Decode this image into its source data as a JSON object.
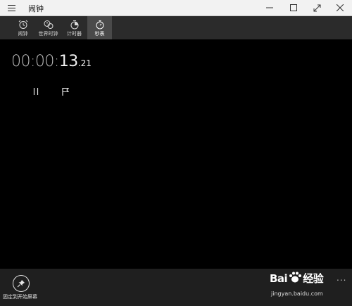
{
  "window": {
    "title": "闹钟",
    "controls": {
      "minimize_icon": "minimize-icon",
      "maximize_icon": "maximize-icon",
      "fullscreen_icon": "fullscreen-icon",
      "close_icon": "close-icon"
    }
  },
  "tabs": [
    {
      "label": "闹钟",
      "icon": "alarm-icon",
      "active": false
    },
    {
      "label": "世界时钟",
      "icon": "world-clock-icon",
      "active": false
    },
    {
      "label": "计时器",
      "icon": "timer-icon",
      "active": false
    },
    {
      "label": "秒表",
      "icon": "stopwatch-icon",
      "active": true
    }
  ],
  "stopwatch": {
    "hours_minutes": "00:00:",
    "seconds": "13",
    "hundredths": ".21",
    "pause_icon": "pause-icon",
    "lap_icon": "flag-icon"
  },
  "bottom_bar": {
    "pin_label": "固定到开始屏幕",
    "more": "..."
  },
  "watermark": {
    "brand": "Bai",
    "brand2": "经验",
    "url": "jingyan.baidu.com"
  },
  "colors": {
    "titlebar": "#f2f2f2",
    "tabbar": "#2b2b2b",
    "active_tab": "#4a4a4a",
    "content": "#000000",
    "bottombar": "#1f1f1f"
  }
}
